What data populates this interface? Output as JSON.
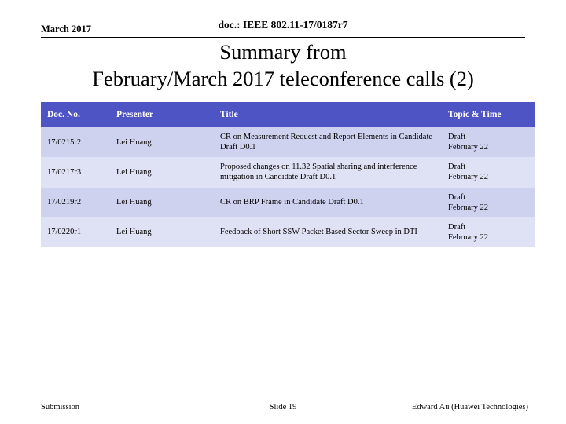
{
  "header": {
    "date": "March 2017",
    "doc_number": "doc.: IEEE 802.11-17/0187r7"
  },
  "title": {
    "line1": "Summary from",
    "line2": "February/March 2017 teleconference calls (2)"
  },
  "colors": {
    "table_header_bg": "#4f54c4",
    "row_dark": "#cfd2ef",
    "row_light": "#dfe1f4",
    "header_text": "#ffffff"
  },
  "table": {
    "columns": [
      "Doc. No.",
      "Presenter",
      "Title",
      "Topic & Time"
    ],
    "rows": [
      {
        "doc_no": "17/0215r2",
        "presenter": "Lei Huang",
        "title": "CR on Measurement Request and Report Elements in Candidate Draft D0.1",
        "topic": "Draft",
        "time": "February 22"
      },
      {
        "doc_no": "17/0217r3",
        "presenter": "Lei Huang",
        "title": "Proposed changes on 11.32 Spatial sharing and interference mitigation in Candidate Draft D0.1",
        "topic": "Draft",
        "time": "February 22"
      },
      {
        "doc_no": "17/0219r2",
        "presenter": "Lei Huang",
        "title": "CR on BRP Frame in Candidate Draft D0.1",
        "topic": "Draft",
        "time": "February 22"
      },
      {
        "doc_no": "17/0220r1",
        "presenter": "Lei Huang",
        "title": "Feedback of Short SSW Packet Based Sector Sweep in DTI",
        "topic": "Draft",
        "time": "February 22"
      }
    ]
  },
  "footer": {
    "left": "Submission",
    "center": "Slide 19",
    "right": "Edward Au (Huawei Technologies)"
  }
}
